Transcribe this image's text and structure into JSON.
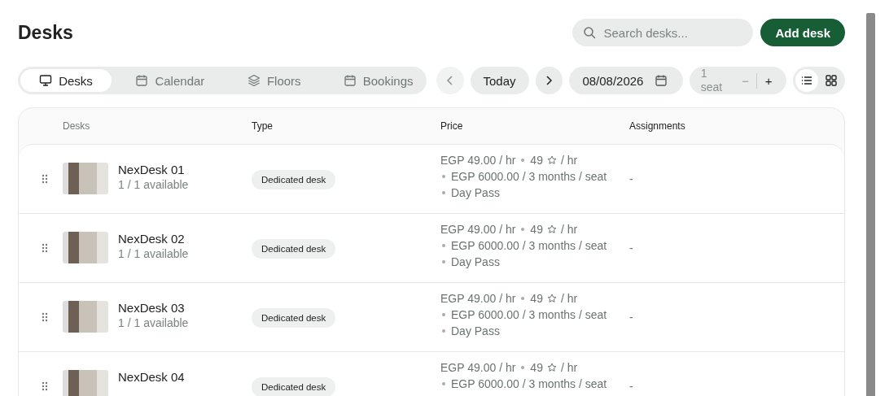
{
  "title": "Desks",
  "search": {
    "placeholder": "Search desks..."
  },
  "add_button": "Add desk",
  "tabs": [
    {
      "label": "Desks",
      "kind": "monitor",
      "selected": true
    },
    {
      "label": "Calendar",
      "kind": "calendar",
      "selected": false
    },
    {
      "label": "Floors",
      "kind": "layers",
      "selected": false
    },
    {
      "label": "Bookings",
      "kind": "calendar",
      "selected": false
    }
  ],
  "today_button": "Today",
  "date": "08/08/2026",
  "seats": {
    "value": "1 seat",
    "minus": "−",
    "plus": "+"
  },
  "views": [
    {
      "kind": "list",
      "selected": true
    },
    {
      "kind": "grid",
      "selected": false
    }
  ],
  "table": {
    "columns": [
      "Desks",
      "Type",
      "Price",
      "Assignments"
    ],
    "rows": [
      {
        "name": "NexDesk 01",
        "availability": "1 / 1 available",
        "type": "Dedicated desk",
        "hourly": "EGP 49.00 / hr",
        "credits": "49",
        "credits_unit": "/ hr",
        "price_lines": [
          "EGP 6000.00 / 3 months / seat",
          "Day Pass"
        ],
        "assignments": "-"
      },
      {
        "name": "NexDesk 02",
        "availability": "1 / 1 available",
        "type": "Dedicated desk",
        "hourly": "EGP 49.00 / hr",
        "credits": "49",
        "credits_unit": "/ hr",
        "price_lines": [
          "EGP 6000.00 / 3 months / seat",
          "Day Pass"
        ],
        "assignments": "-"
      },
      {
        "name": "NexDesk 03",
        "availability": "1 / 1 available",
        "type": "Dedicated desk",
        "hourly": "EGP 49.00 / hr",
        "credits": "49",
        "credits_unit": "/ hr",
        "price_lines": [
          "EGP 6000.00 / 3 months / seat",
          "Day Pass"
        ],
        "assignments": "-"
      },
      {
        "name": "NexDesk 04",
        "type": "Dedicated desk",
        "hourly": "EGP 49.00 / hr",
        "credits": "49",
        "credits_unit": "/ hr",
        "price_lines": [
          "EGP 6000.00 / 3 months / seat"
        ],
        "assignments": "-"
      }
    ]
  }
}
